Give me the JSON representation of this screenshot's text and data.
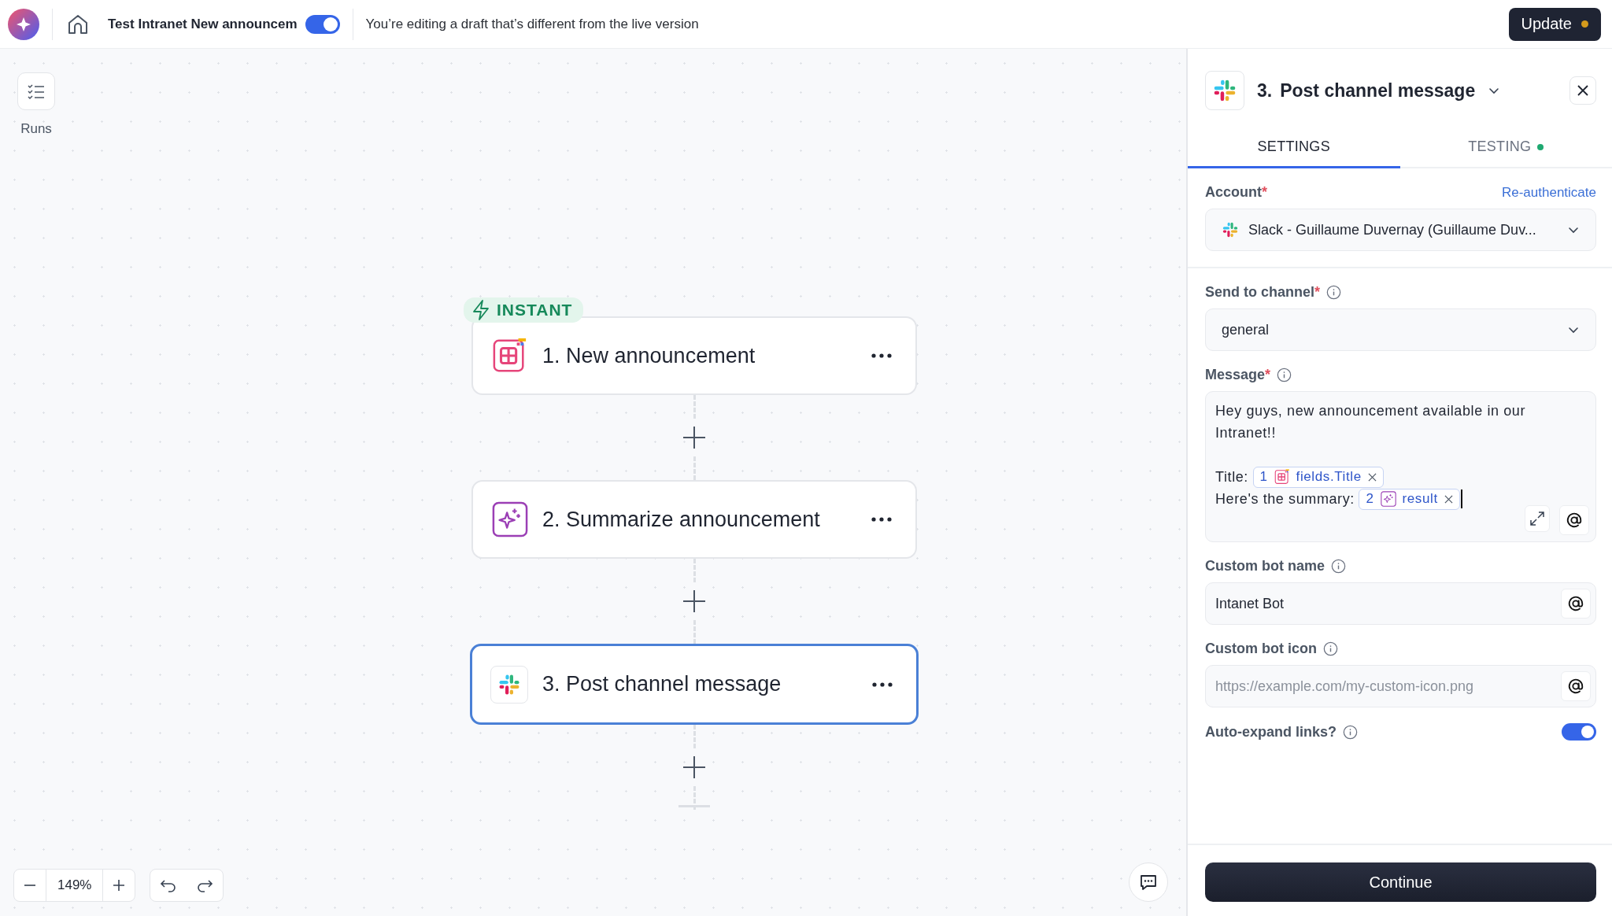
{
  "topbar": {
    "title": "Test Intranet New announcem",
    "toggle_on": true,
    "notice": "You’re editing a draft that’s different from the live version",
    "update_button": {
      "label": "Update",
      "has_changes": true
    }
  },
  "canvas": {
    "runs_label": "Runs",
    "trigger_badge": "INSTANT",
    "steps": [
      {
        "title": "1. New announcement",
        "kind": "table",
        "selected": false
      },
      {
        "title": "2. Summarize announcement",
        "kind": "ai",
        "selected": false
      },
      {
        "title": "3. Post channel message",
        "kind": "slack",
        "selected": true
      }
    ],
    "zoom": "149%"
  },
  "panel": {
    "step_number": "3.",
    "title": "Post channel message",
    "tabs": [
      {
        "label": "SETTINGS",
        "selected": true
      },
      {
        "label": "TESTING",
        "selected": false,
        "color": "#1fa971"
      }
    ],
    "fields": [
      {
        "kind": "app-select",
        "label": "Account",
        "required_mark": "*",
        "action": "Re-authenticate",
        "value": "Slack - Guillaume Duvernay (Guillaume Duv...",
        "divider_after": true
      },
      {
        "kind": "select",
        "label": "Send to channel",
        "required_mark": "*",
        "info": true,
        "value": "general"
      },
      {
        "kind": "message",
        "label": "Message",
        "required_mark": "*",
        "info": true,
        "lines": [
          {
            "text": "Hey guys, new announcement available in our Intranet!!"
          },
          {
            "text": "Title: ",
            "gap_before": true,
            "token": {
              "step": "1",
              "kind": "table",
              "field": "fields.Title"
            }
          },
          {
            "text": "Here's the summary: ",
            "token": {
              "step": "2",
              "kind": "ai",
              "field": "result"
            },
            "cursor": true
          }
        ]
      },
      {
        "kind": "text",
        "label": "Custom bot name",
        "info": true,
        "value": "Intanet Bot"
      },
      {
        "kind": "text",
        "label": "Custom bot icon",
        "info": true,
        "placeholder": "https://example.com/my-custom-icon.png"
      },
      {
        "kind": "toggle",
        "label": "Auto-expand links?",
        "info": true,
        "on": true
      }
    ],
    "continue_button": "Continue"
  }
}
